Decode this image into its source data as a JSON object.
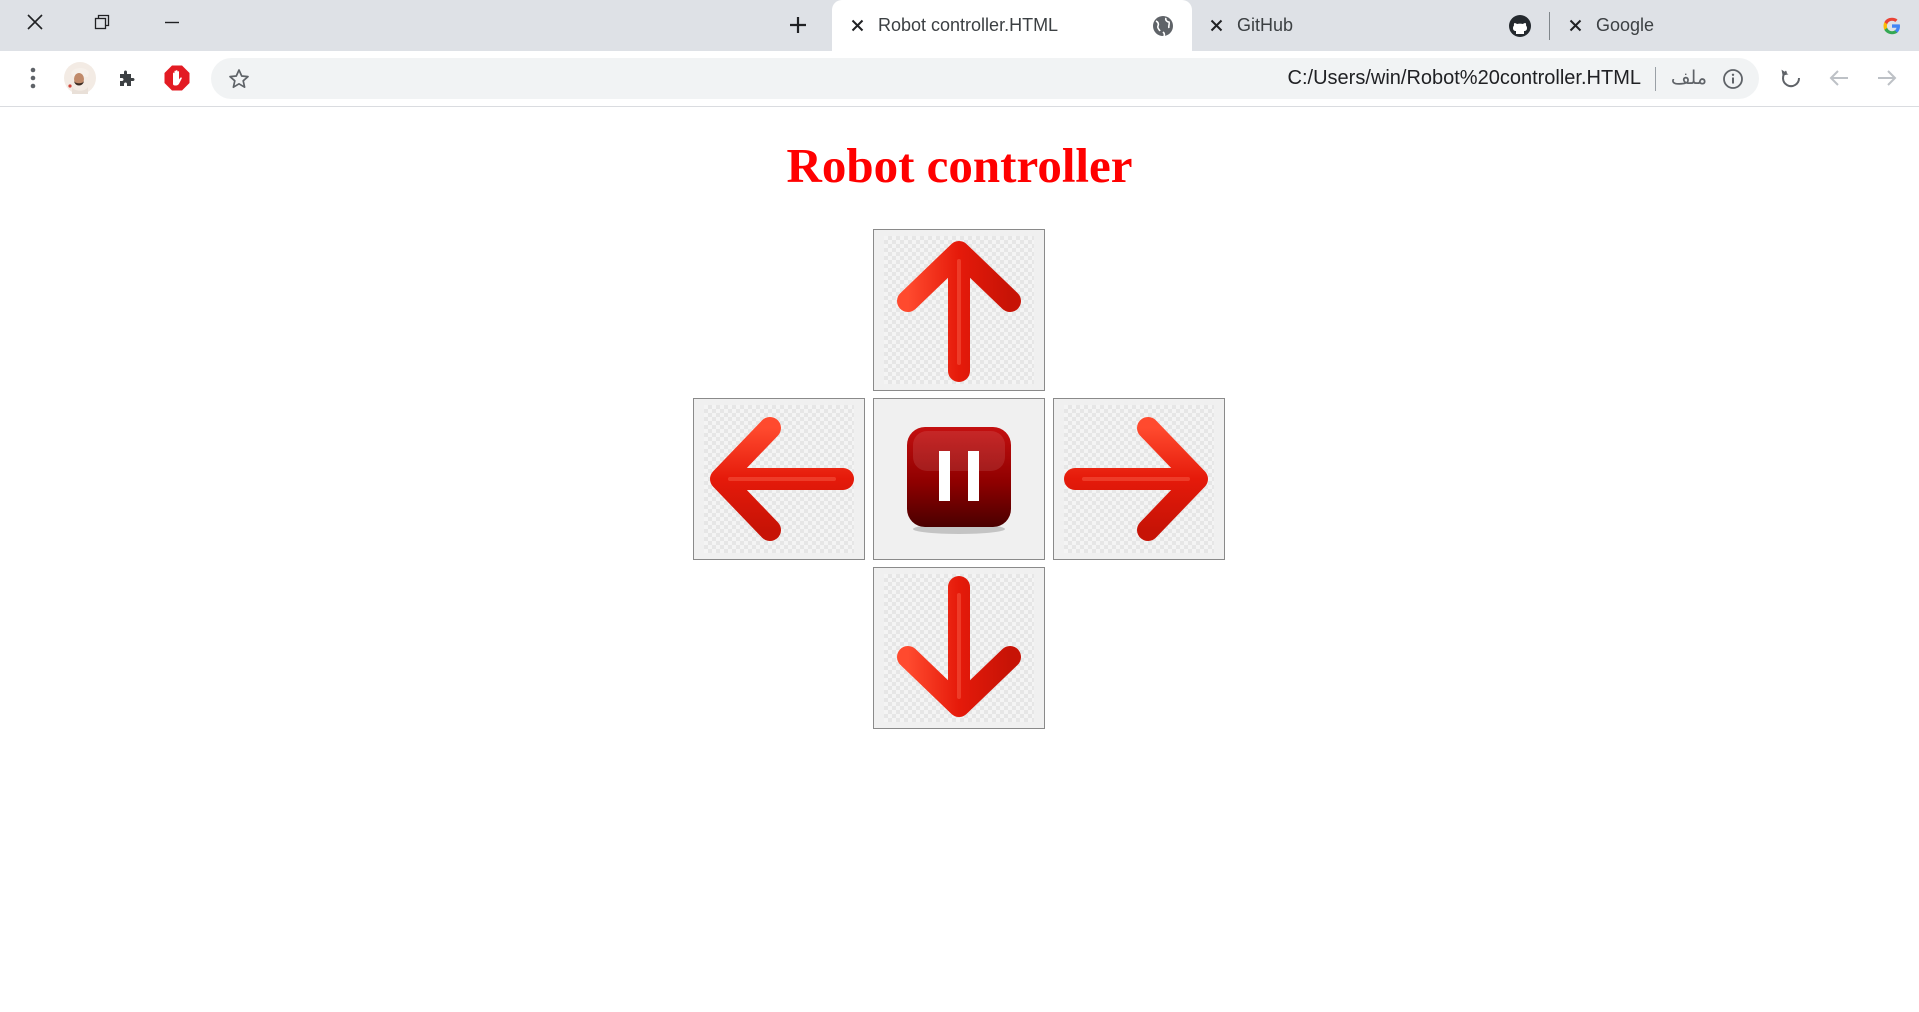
{
  "browser": {
    "tabs": [
      {
        "title": "Robot controller.HTML",
        "favicon": "globe-icon",
        "active": true
      },
      {
        "title": "GitHub",
        "favicon": "github-icon",
        "active": false
      },
      {
        "title": "Google",
        "favicon": "google-g-icon",
        "active": false
      }
    ],
    "address_bar": {
      "url": "C:/Users/win/Robot%20controller.HTML",
      "scheme_label": "ملف"
    }
  },
  "page": {
    "title": "Robot controller",
    "title_color": "#ff0000",
    "buttons": [
      {
        "id": "up",
        "icon": "arrow-up-icon"
      },
      {
        "id": "left",
        "icon": "arrow-left-icon"
      },
      {
        "id": "stop",
        "icon": "pause-icon"
      },
      {
        "id": "right",
        "icon": "arrow-right-icon"
      },
      {
        "id": "down",
        "icon": "arrow-down-icon"
      }
    ]
  },
  "colors": {
    "arrow": "#ee1b0e",
    "pause": "#8b0000"
  }
}
